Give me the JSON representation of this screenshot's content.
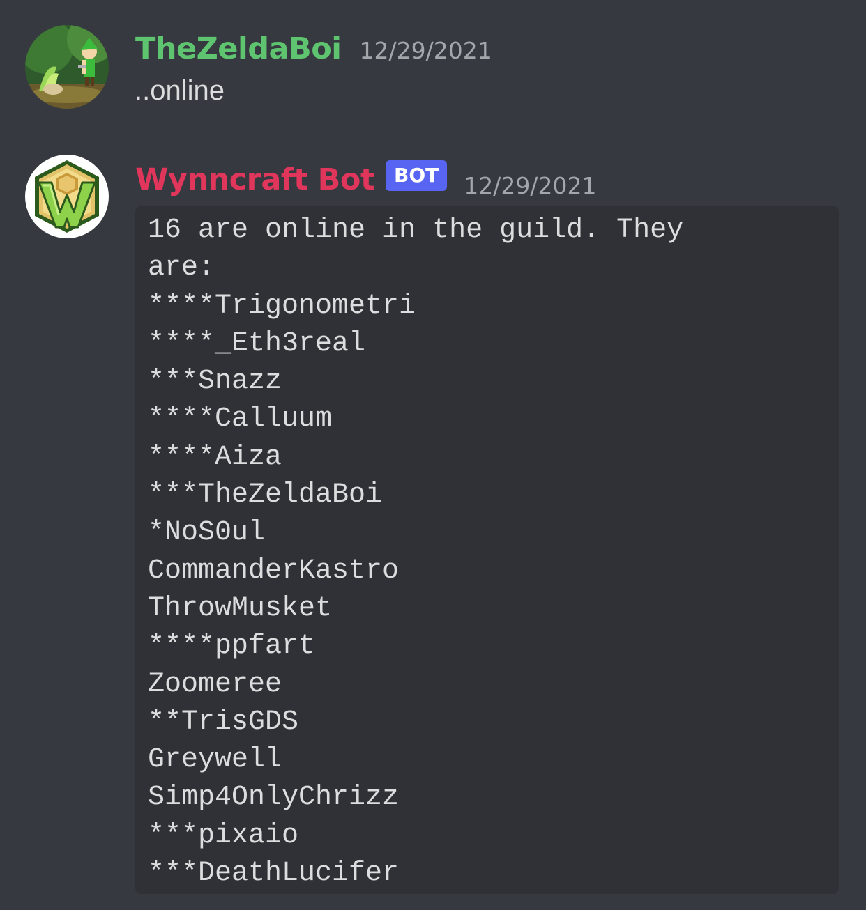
{
  "messages": [
    {
      "username": "TheZeldaBoi",
      "timestamp": "12/29/2021",
      "text": "..online"
    },
    {
      "username": "Wynncraft Bot",
      "bot_tag": "BOT",
      "timestamp": "12/29/2021",
      "code_lines": [
        "16 are online in the guild. They",
        "are:",
        "****Trigonometri",
        "****_Eth3real",
        "***Snazz",
        "****Calluum",
        "****Aiza",
        "***TheZeldaBoi",
        "*NoS0ul",
        "CommanderKastro",
        "ThrowMusket",
        "****ppfart",
        "Zoomeree",
        "**TrisGDS",
        "Greywell",
        "Simp4OnlyChrizz",
        "***pixaio",
        "***DeathLucifer"
      ]
    }
  ],
  "colors": {
    "background": "#36393f",
    "codeblock_bg": "#2f3136",
    "zelda_name": "#5fc46f",
    "bot_name": "#e0365c",
    "bot_tag": "#5865f2",
    "timestamp": "#a3a6aa",
    "text": "#dcddde"
  }
}
